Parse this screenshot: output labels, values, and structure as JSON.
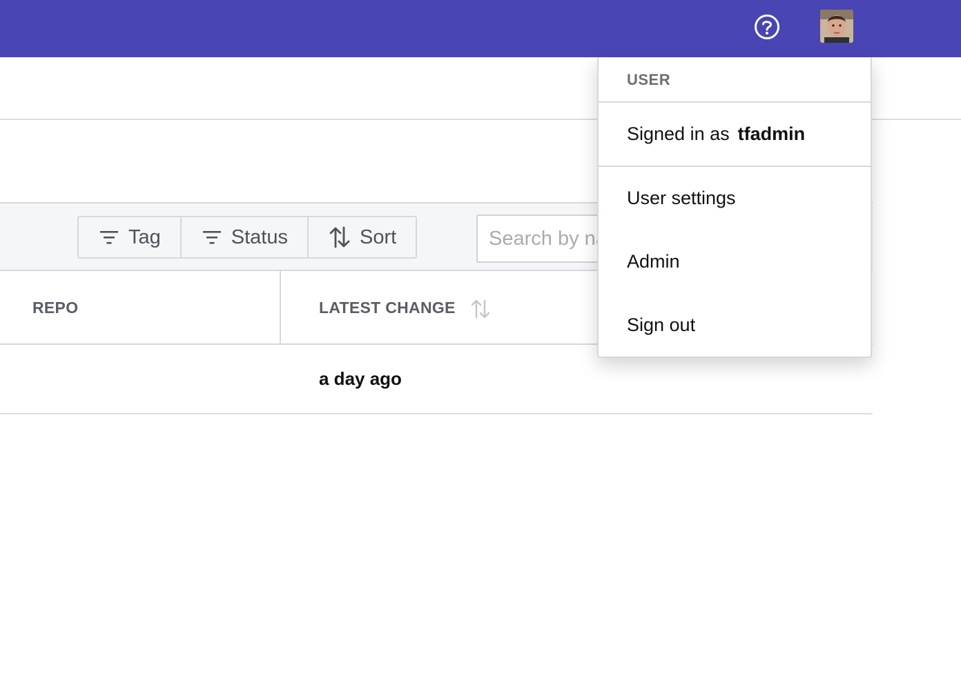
{
  "topbar": {
    "bg_color": "#4945b5",
    "help_icon": "question-circle-icon",
    "avatar": "user-avatar"
  },
  "toolbar": {
    "tag_label": "Tag",
    "status_label": "Status",
    "sort_label": "Sort",
    "search_placeholder": "Search by na"
  },
  "table": {
    "headers": [
      "REPO",
      "LATEST CHANGE"
    ],
    "rows": [
      {
        "repo": "",
        "latest_change": "a day ago"
      }
    ]
  },
  "user_menu": {
    "header": "USER",
    "signed_in_prefix": "Signed in as",
    "username": "tfadmin",
    "items": [
      "User settings",
      "Admin",
      "Sign out"
    ]
  }
}
